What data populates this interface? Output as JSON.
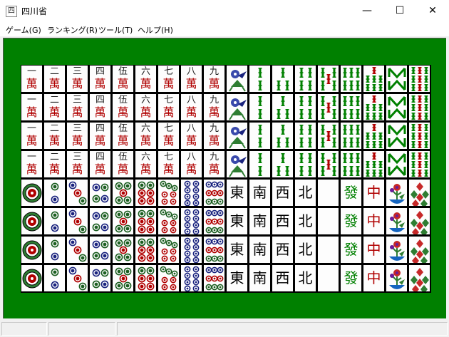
{
  "window": {
    "title": "四川省",
    "app_icon_glyph": "四",
    "buttons": [
      "minimize-button",
      "maximize-button",
      "close-button"
    ]
  },
  "menu": {
    "items": [
      {
        "label": "ゲーム(G)"
      },
      {
        "label": "ランキング(R)"
      },
      {
        "label": "ツール(T)"
      },
      {
        "label": "ヘルプ(H)"
      }
    ]
  },
  "board": {
    "background": "#008000",
    "rows": 8,
    "cols": 18,
    "man_numerals": [
      "一",
      "二",
      "三",
      "四",
      "伍",
      "六",
      "七",
      "八",
      "九"
    ],
    "man_suffix": "萬",
    "honors": [
      "東",
      "南",
      "西",
      "北",
      "",
      "發",
      "中",
      "flower-tile",
      "season-tile"
    ],
    "bamboo_tiles": [
      "one-bamboo-bird",
      "2",
      "3",
      "4",
      "5",
      "6",
      "7",
      "8",
      "9"
    ],
    "circle_counts": [
      1,
      2,
      3,
      4,
      5,
      6,
      7,
      8,
      9
    ]
  },
  "colors": {
    "man_red": "#b00000",
    "bamboo_green": "#008000",
    "circle_blue": "#1a237e",
    "circle_red": "#b00000"
  },
  "statusbar": {
    "panes": 3
  }
}
